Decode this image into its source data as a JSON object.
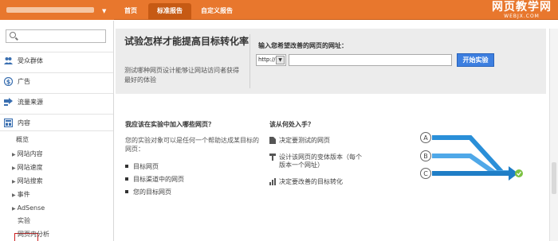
{
  "topnav": {
    "tabs": [
      "首页",
      "标准报告",
      "自定义报告"
    ],
    "active_tab": "标准报告"
  },
  "watermark": {
    "line1": "网页教学网",
    "line2": "WEBJX.COM"
  },
  "sidebar": {
    "sections": [
      "受众群体",
      "广告",
      "流量来源",
      "内容"
    ],
    "content_items": [
      "概览",
      "网站内容",
      "网站速度",
      "网站搜索",
      "事件",
      "AdSense",
      "实验",
      "网页内分析"
    ],
    "selected_item": "实验"
  },
  "header": {
    "title": "试验怎样才能提高目标转化率",
    "description": "测试哪种网页设计能够让网站访问者获得最好的体验",
    "url_label": "输入您希望改善的网页的网址：",
    "protocol": "http://",
    "start_button": "开始实验"
  },
  "left_col": {
    "heading": "我应该在实验中加入哪些网页？",
    "text": "您的实验对象可以是任何一个帮助达成某目标的网页：",
    "bullets": [
      "目标网页",
      "目标渠道中的网页",
      "您的目标网页"
    ]
  },
  "right_col": {
    "heading": "该从何处入手？",
    "steps": [
      "决定要测试的网页",
      "设计该网页的变体版本（每个版本一个网址）",
      "决定要改善的目标转化"
    ]
  },
  "diagram_labels": [
    "A",
    "B",
    "C"
  ],
  "colors": {
    "brand_orange": "#e8772d",
    "tab_active": "#c65a14",
    "button_blue": "#3d7fe0",
    "arrow_blue": "#2a8fd8",
    "check_green": "#7cc242"
  }
}
